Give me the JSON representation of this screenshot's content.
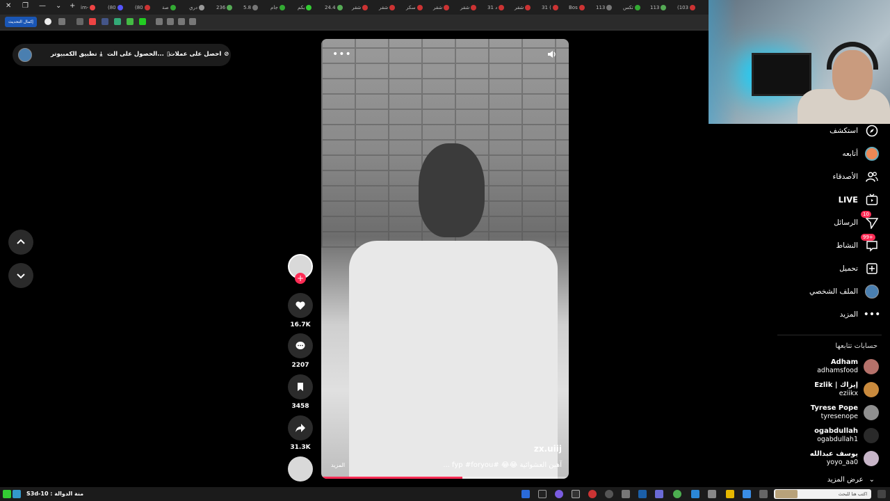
{
  "browser": {
    "tabs": [
      "im-",
      "(80",
      "(80",
      "صة",
      "دري",
      "236",
      "5.8",
      "جام",
      "بكم",
      "24.4",
      "شقر",
      "شقر",
      "سكر",
      "شقر",
      "شقر",
      "31 د",
      "شقر",
      "31 (",
      "Bos",
      "113",
      "تكس",
      "113",
      "(103"
    ],
    "update_button": "إكمال التحديث"
  },
  "topbar": {
    "coins": "احصل على عملات",
    "get_app": "الحصول على الت...",
    "desktop_app": "تطبيق الكمبيوتر"
  },
  "video": {
    "username": "zx.uiij",
    "caption": "آهين العشوائية 😂😂 #fyp #foryou ...",
    "more": "المزيد",
    "menu": "•••",
    "progress": 0.57
  },
  "actions": {
    "likes": "16.7K",
    "comments": "2207",
    "saves": "3458",
    "shares": "31.3K"
  },
  "sidebar": {
    "explore": "استكشف",
    "following": "أتابعه",
    "friends": "الأصدقاء",
    "live": "LIVE",
    "messages": "الرسائل",
    "messages_badge": "10",
    "activity": "النشاط",
    "activity_badge": "99+",
    "upload": "تحميل",
    "profile": "الملف الشخصي",
    "more": "المزيد",
    "following_accounts_heading": "حسابات تتابعها",
    "accounts": [
      {
        "name": "Adham",
        "user": "adhamsfood",
        "color": "#b5716a"
      },
      {
        "name": "Ezlik | إيزاك",
        "user": "eziikx",
        "color": "#c98a3d"
      },
      {
        "name": "Tyrese Pope",
        "user": "tyresenope",
        "color": "#8f8f8f"
      },
      {
        "name": "ogabdullah",
        "user": "ogabdullah1",
        "color": "#2a2a2a"
      },
      {
        "name": "يوسف عبدالله",
        "user": "yoyo_aa0",
        "color": "#c7b5c8"
      }
    ],
    "see_more": "عرض المزيد"
  },
  "taskbar": {
    "label": "S3d-10 : منة الدوالة",
    "search_placeholder": "اكتب هنا للبحث"
  }
}
